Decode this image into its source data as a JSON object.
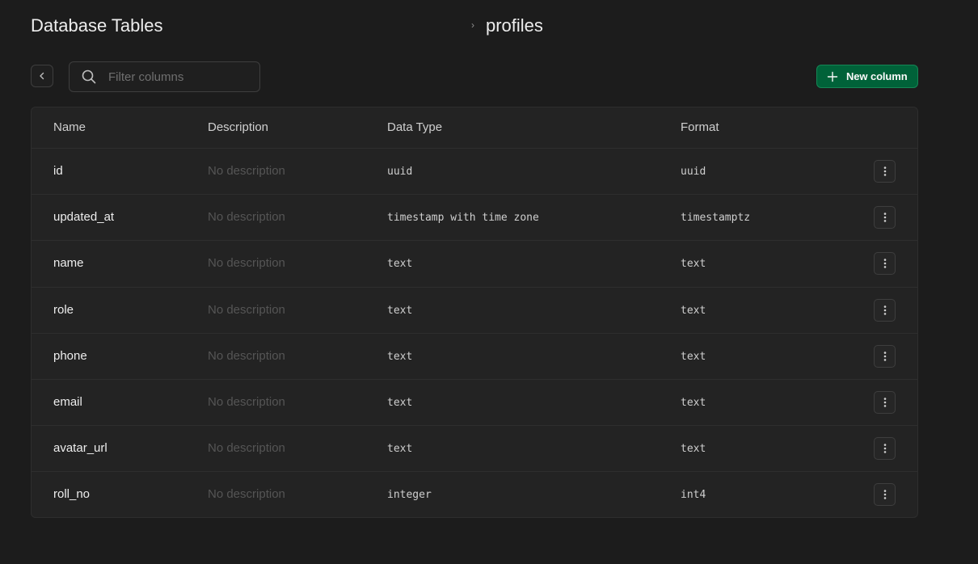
{
  "header": {
    "title": "Database Tables",
    "breadcrumb_separator": "›",
    "current_table": "profiles"
  },
  "toolbar": {
    "back_icon": "chevron-left-icon",
    "search_icon": "search-icon",
    "search_placeholder": "Filter columns",
    "search_value": "",
    "new_column_icon": "plus-icon",
    "new_column_label": "New column"
  },
  "table": {
    "headers": [
      "Name",
      "Description",
      "Data Type",
      "Format"
    ],
    "rows": [
      {
        "name": "id",
        "description": "No description",
        "data_type": "uuid",
        "format": "uuid"
      },
      {
        "name": "updated_at",
        "description": "No description",
        "data_type": "timestamp with time zone",
        "format": "timestamptz"
      },
      {
        "name": "name",
        "description": "No description",
        "data_type": "text",
        "format": "text"
      },
      {
        "name": "role",
        "description": "No description",
        "data_type": "text",
        "format": "text"
      },
      {
        "name": "phone",
        "description": "No description",
        "data_type": "text",
        "format": "text"
      },
      {
        "name": "email",
        "description": "No description",
        "data_type": "text",
        "format": "text"
      },
      {
        "name": "avatar_url",
        "description": "No description",
        "data_type": "text",
        "format": "text"
      },
      {
        "name": "roll_no",
        "description": "No description",
        "data_type": "integer",
        "format": "int4"
      }
    ],
    "row_action_icon": "more-vertical-icon"
  },
  "colors": {
    "background": "#1c1c1c",
    "surface": "#232323",
    "border": "#2e2e2e",
    "accent": "#006239"
  }
}
